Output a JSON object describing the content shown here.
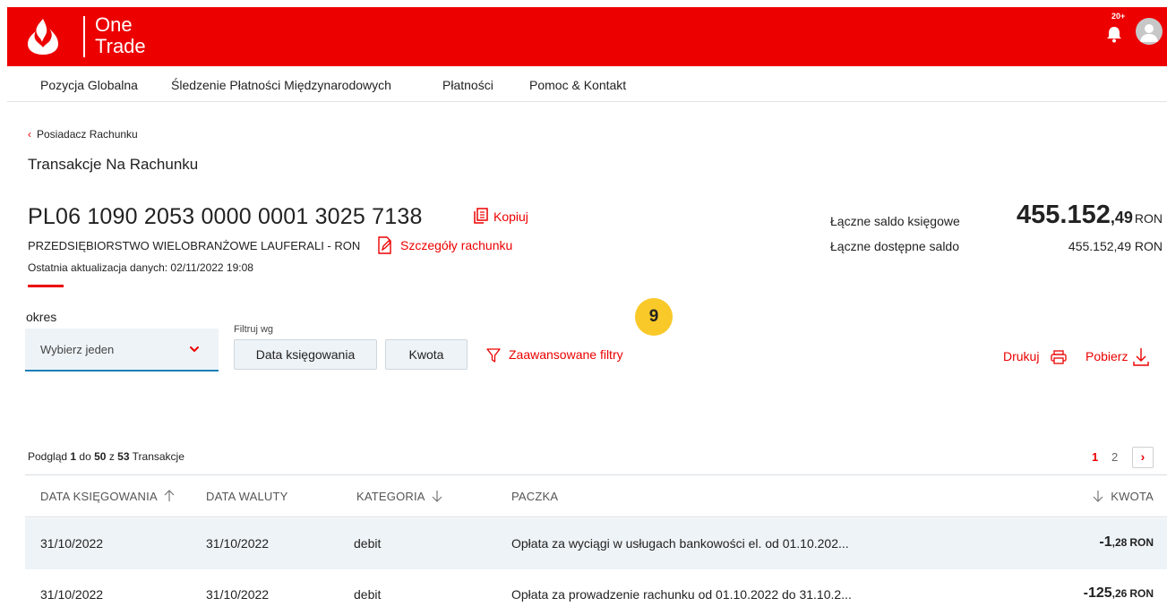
{
  "header": {
    "brand_line1": "One",
    "brand_line2": "Trade",
    "notification_badge": "20+",
    "icons": [
      "santander-flame-logo",
      "bell-icon",
      "user-avatar-icon"
    ],
    "brand_color": "#ec0000"
  },
  "nav": {
    "items": [
      "Pozycja Globalna",
      "Śledzenie Płatności Międzynarodowych",
      "Płatności",
      "Pomoc & Kontakt"
    ]
  },
  "breadcrumb": {
    "label": "Posiadacz Rachunku"
  },
  "page_title": "Transakcje Na Rachunku",
  "account": {
    "number": "PL06 1090 2053 0000 0001 3025 7138",
    "copy_label": "Kopiuj",
    "holder": "PRZEDSIĘBIORSTWO WIELOBRANŻOWE LAUFERALI - RON",
    "details_label": "Szczegóły rachunku",
    "last_update": "Ostatnia aktualizacja danych: 02/11/2022 19:08"
  },
  "balance": {
    "book_label": "Łączne saldo księgowe",
    "book_int": "455.152",
    "book_dec": ",49",
    "book_cur": "RON",
    "available_label": "Łączne dostępne saldo",
    "available_value": "455.152,49 RON"
  },
  "step_badge": "9",
  "filters": {
    "period_label": "okres",
    "period_value": "Wybierz jeden",
    "filter_by_label": "Filtruj wg",
    "chip_date": "Data księgowania",
    "chip_amount": "Kwota",
    "advanced_label": "Zaawansowane filtry",
    "print_label": "Drukuj",
    "download_label": "Pobierz"
  },
  "summary": {
    "prefix": "Podgląd",
    "from": "1",
    "to_word": "do",
    "to": "50",
    "of_word": "z",
    "total": "53",
    "suffix": "Transakcje"
  },
  "pagination": {
    "pages": [
      "1",
      "2"
    ],
    "current": "1",
    "next": "›"
  },
  "table": {
    "headers": [
      "DATA KSIĘGOWANIA",
      "DATA WALUTY",
      "KATEGORIA",
      "PACZKA",
      "KWOTA"
    ],
    "rows": [
      {
        "booking_date": "31/10/2022",
        "value_date": "31/10/2022",
        "category": "debit",
        "description": "Opłata za wyciągi w usługach bankowości el. od 01.10.202...",
        "amount_int": "-1",
        "amount_dec": ",28",
        "amount_cur": "RON"
      },
      {
        "booking_date": "31/10/2022",
        "value_date": "31/10/2022",
        "category": "debit",
        "description": "Opłata za prowadzenie rachunku od 01.10.2022 do 31.10.2...",
        "amount_int": "-125",
        "amount_dec": ",26",
        "amount_cur": "RON"
      }
    ]
  }
}
